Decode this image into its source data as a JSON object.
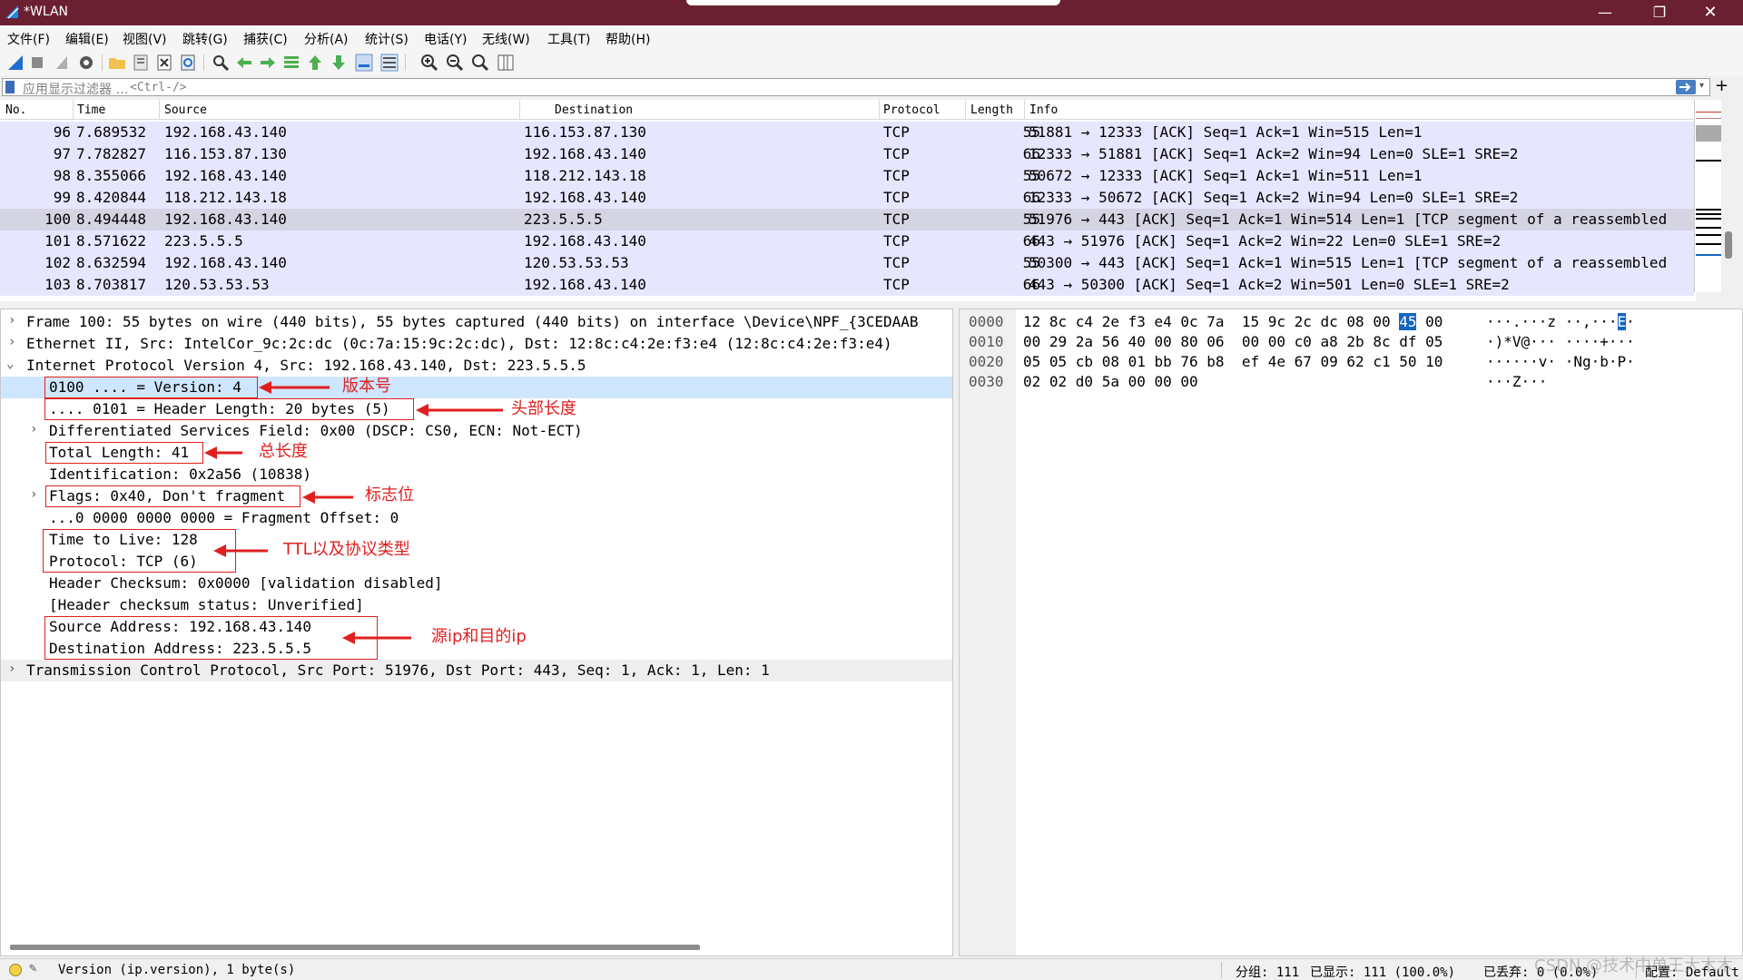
{
  "titlebar": {
    "title": "*WLAN",
    "minimize": "—",
    "maximize": "❐",
    "close": "✕"
  },
  "menu": [
    "文件(F)",
    "编辑(E)",
    "视图(V)",
    "跳转(G)",
    "捕获(C)",
    "分析(A)",
    "统计(S)",
    "电话(Y)",
    "无线(W)",
    "工具(T)",
    "帮助(H)"
  ],
  "filter": {
    "placeholder": "应用显示过滤器 …",
    "shortcut": "<Ctrl-/>",
    "add": "+"
  },
  "packet_list": {
    "headers": [
      "No.",
      "Time",
      "Source",
      "Destination",
      "Protocol",
      "Length",
      "Info"
    ],
    "rows": [
      {
        "no": "96",
        "time": "7.689532",
        "src": "192.168.43.140",
        "dst": "116.153.87.130",
        "proto": "TCP",
        "len": "55",
        "info": "51881 → 12333 [ACK] Seq=1 Ack=1 Win=515 Len=1"
      },
      {
        "no": "97",
        "time": "7.782827",
        "src": "116.153.87.130",
        "dst": "192.168.43.140",
        "proto": "TCP",
        "len": "66",
        "info": "12333 → 51881 [ACK] Seq=1 Ack=2 Win=94 Len=0 SLE=1 SRE=2"
      },
      {
        "no": "98",
        "time": "8.355066",
        "src": "192.168.43.140",
        "dst": "118.212.143.18",
        "proto": "TCP",
        "len": "55",
        "info": "50672 → 12333 [ACK] Seq=1 Ack=1 Win=511 Len=1"
      },
      {
        "no": "99",
        "time": "8.420844",
        "src": "118.212.143.18",
        "dst": "192.168.43.140",
        "proto": "TCP",
        "len": "66",
        "info": "12333 → 50672 [ACK] Seq=1 Ack=2 Win=94 Len=0 SLE=1 SRE=2"
      },
      {
        "no": "100",
        "time": "8.494448",
        "src": "192.168.43.140",
        "dst": "223.5.5.5",
        "proto": "TCP",
        "len": "55",
        "info": "51976 → 443 [ACK] Seq=1 Ack=1 Win=514 Len=1 [TCP segment of a reassembled"
      },
      {
        "no": "101",
        "time": "8.571622",
        "src": "223.5.5.5",
        "dst": "192.168.43.140",
        "proto": "TCP",
        "len": "66",
        "info": "443 → 51976 [ACK] Seq=1 Ack=2 Win=22 Len=0 SLE=1 SRE=2"
      },
      {
        "no": "102",
        "time": "8.632594",
        "src": "192.168.43.140",
        "dst": "120.53.53.53",
        "proto": "TCP",
        "len": "55",
        "info": "50300 → 443 [ACK] Seq=1 Ack=1 Win=515 Len=1 [TCP segment of a reassembled"
      },
      {
        "no": "103",
        "time": "8.703817",
        "src": "120.53.53.53",
        "dst": "192.168.43.140",
        "proto": "TCP",
        "len": "66",
        "info": "443 → 50300 [ACK] Seq=1 Ack=2 Win=501 Len=0 SLE=1 SRE=2"
      }
    ],
    "selected_no": "100"
  },
  "details": {
    "frame": "Frame 100: 55 bytes on wire (440 bits), 55 bytes captured (440 bits) on interface \\Device\\NPF_{3CEDAAB",
    "ethernet": "Ethernet II, Src: IntelCor_9c:2c:dc (0c:7a:15:9c:2c:dc), Dst: 12:8c:c4:2e:f3:e4 (12:8c:c4:2e:f3:e4)",
    "ip": "Internet Protocol Version 4, Src: 192.168.43.140, Dst: 223.5.5.5",
    "version": "0100 .... = Version: 4",
    "header_length": ".... 0101 = Header Length: 20 bytes (5)",
    "dsfield": "Differentiated Services Field: 0x00 (DSCP: CS0, ECN: Not-ECT)",
    "total_length": "Total Length: 41",
    "identification": "Identification: 0x2a56 (10838)",
    "flags": "Flags: 0x40, Don't fragment",
    "frag_offset": "...0 0000 0000 0000 = Fragment Offset: 0",
    "ttl": "Time to Live: 128",
    "protocol": "Protocol: TCP (6)",
    "checksum": "Header Checksum: 0x0000 [validation disabled]",
    "checksum_status": "[Header checksum status: Unverified]",
    "src_addr": "Source Address: 192.168.43.140",
    "dst_addr": "Destination Address: 223.5.5.5",
    "tcp": "Transmission Control Protocol, Src Port: 51976, Dst Port: 443, Seq: 1, Ack: 1, Len: 1"
  },
  "annotations": {
    "version": "版本号",
    "header_length": "头部长度",
    "total_length": "总长度",
    "flags": "标志位",
    "ttl_proto": "TTL以及协议类型",
    "addresses": "源ip和目的ip",
    "color": "#e02020"
  },
  "bytes": {
    "rows": [
      {
        "off": "0000",
        "hex_pre": "12 8c c4 2e f3 e4 0c 7a  15 9c 2c dc 08 00 ",
        "hex_hl": "45",
        "hex_post": " 00",
        "asc_pre": "···.···z ··,···",
        "asc_hl": "E",
        "asc_post": "·"
      },
      {
        "off": "0010",
        "hex_pre": "00 29 2a 56 40 00 80 06  00 00 c0 a8 2b 8c df 05",
        "hex_hl": "",
        "hex_post": "",
        "asc_pre": "·)*V@··· ····+···",
        "asc_hl": "",
        "asc_post": ""
      },
      {
        "off": "0020",
        "hex_pre": "05 05 cb 08 01 bb 76 b8  ef 4e 67 09 62 c1 50 10",
        "hex_hl": "",
        "hex_post": "",
        "asc_pre": "······v· ·Ng·b·P·",
        "asc_hl": "",
        "asc_post": ""
      },
      {
        "off": "0030",
        "hex_pre": "02 02 d0 5a 00 00 00",
        "hex_hl": "",
        "hex_post": "",
        "asc_pre": "···Z···",
        "asc_hl": "",
        "asc_post": ""
      }
    ],
    "highlight_color": "#1565c0"
  },
  "status": {
    "field": "Version (ip.version), 1 byte(s)",
    "packets": "分组: 111",
    "displayed": "已显示: 111 (100.0%)",
    "dropped": "已丢弃: 0 (0.0%)",
    "profile": "配置: Default"
  },
  "watermark": "CSDN @技术中单王大木木"
}
